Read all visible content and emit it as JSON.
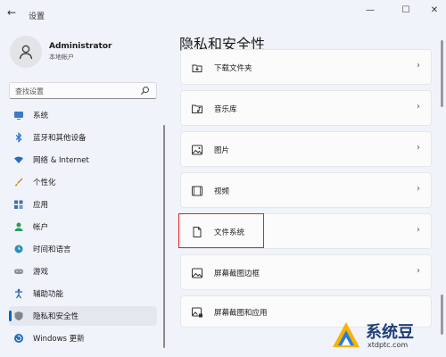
{
  "window": {
    "app_title": "设置",
    "back_glyph": "←",
    "minimize_glyph": "—",
    "maximize_glyph": "☐",
    "close_glyph": "✕"
  },
  "user": {
    "name": "Administrator",
    "type": "本地帐户"
  },
  "search": {
    "placeholder": "查找设置"
  },
  "sidebar": {
    "items": [
      {
        "label": "系统",
        "icon": "monitor-icon"
      },
      {
        "label": "蓝牙和其他设备",
        "icon": "bluetooth-icon"
      },
      {
        "label": "网络 & Internet",
        "icon": "wifi-icon"
      },
      {
        "label": "个性化",
        "icon": "brush-icon"
      },
      {
        "label": "应用",
        "icon": "apps-icon"
      },
      {
        "label": "帐户",
        "icon": "person-icon"
      },
      {
        "label": "时间和语言",
        "icon": "globe-clock-icon"
      },
      {
        "label": "游戏",
        "icon": "gamepad-icon"
      },
      {
        "label": "辅助功能",
        "icon": "accessibility-icon"
      },
      {
        "label": "隐私和安全性",
        "icon": "shield-icon",
        "active": true
      },
      {
        "label": "Windows 更新",
        "icon": "update-icon"
      }
    ]
  },
  "main": {
    "title": "隐私和安全性",
    "cards": [
      {
        "label": "下载文件夹",
        "icon": "download-folder-icon"
      },
      {
        "label": "音乐库",
        "icon": "music-folder-icon"
      },
      {
        "label": "图片",
        "icon": "picture-icon"
      },
      {
        "label": "视频",
        "icon": "video-icon"
      },
      {
        "label": "文件系统",
        "icon": "document-icon"
      },
      {
        "label": "屏幕截图边框",
        "icon": "screenshot-border-icon"
      },
      {
        "label": "屏幕截图和应用",
        "icon": "screenshot-app-icon"
      }
    ],
    "chevron": "›"
  },
  "watermark": {
    "text": "系统豆",
    "subtext": "xtdptc.com"
  },
  "colors": {
    "accent": "#0067c0",
    "highlight": "#d8262b"
  }
}
